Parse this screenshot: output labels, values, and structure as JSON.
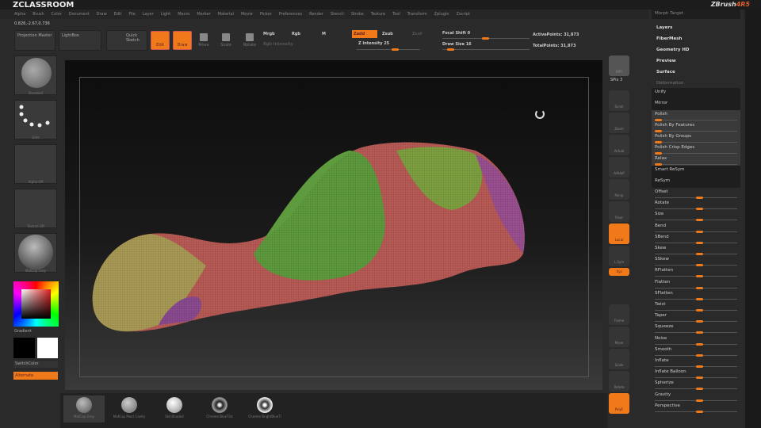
{
  "title": "ZCLASSROOM",
  "logo": {
    "main": "ZBrush",
    "version": "4R5"
  },
  "menu": [
    "Alpha",
    "Brush",
    "Color",
    "Document",
    "Draw",
    "Edit",
    "File",
    "Layer",
    "Light",
    "Macro",
    "Marker",
    "Material",
    "Movie",
    "Picker",
    "Preferences",
    "Render",
    "Stencil",
    "Stroke",
    "Texture",
    "Tool",
    "Transform",
    "Zplugin",
    "Zscript"
  ],
  "coords": "0.826,-2.67,0.736",
  "top": {
    "projection_master": "Projection Master",
    "lightbox": "LightBox",
    "quick_sketch": "Quick Sketch",
    "edit": "Edit",
    "draw": "Draw",
    "move": "Move",
    "scale": "Scale",
    "rotate": "Rotate",
    "mrgb": "Mrgb",
    "rgb": "Rgb",
    "m": "M",
    "rgb_intensity": "Rgb Intensity",
    "zadd": "Zadd",
    "zsub": "Zsub",
    "zcut": "Zcut",
    "z_intensity": "Z Intensity 25",
    "focal_shift": "Focal Shift 0",
    "draw_size": "Draw Size 16",
    "active_points": "ActivePoints: 31,873",
    "total_points": "TotalPoints: 31,873",
    "z_intensity_value": 25,
    "focal_shift_value": 0,
    "draw_size_value": 16
  },
  "left": {
    "brush": "Standard",
    "stroke": "Dots",
    "alpha": "Alpha Off",
    "texture": "Texture Off",
    "material": "MatCap Gray",
    "gradient": "Gradient",
    "switch_color": "SwitchColor",
    "alternate": "Alternate"
  },
  "right_shelf": [
    "Scroll",
    "Zoom",
    "Actual",
    "AAHalf",
    "Persp",
    "Floor",
    "Local",
    "L.Sym",
    "Xyz",
    "Frame",
    "Move",
    "Scale",
    "Rotate",
    "PolyF"
  ],
  "right_shelf_top": {
    "bpr": "BPR",
    "spix": "SPix 3"
  },
  "panel": {
    "top_item": "Morph Target",
    "sections": [
      "Layers",
      "FiberMesh",
      "Geometry HD",
      "Preview",
      "Surface",
      "Deformation"
    ],
    "buttons": [
      "Unify",
      "Mirror"
    ],
    "polish": [
      "Polish",
      "Polish By Features",
      "Polish By Groups",
      "Polish Crisp Edges",
      "Relax"
    ],
    "buttons2": [
      "Smart ReSym",
      "ReSym"
    ],
    "sliders": [
      "Offset",
      "Rotate",
      "Size",
      "Bend",
      "SBend",
      "Skew",
      "SSkew",
      "RFlatten",
      "Flatten",
      "SFlatten",
      "Twist",
      "Taper",
      "Squeeze",
      "Noise",
      "Smooth",
      "Inflate",
      "Inflate Balloon",
      "Spherize",
      "Gravity",
      "Perspective"
    ]
  },
  "materials": [
    "MatCap Gray",
    "MatCap Pearl Cavity",
    "SkinShade4",
    "Chrome BlueTint",
    "Chrome BrightBlueTi"
  ],
  "colors": {
    "accent": "#f07a1a",
    "red_group": "#b85a55",
    "green_group": "#5e9a3e",
    "yellow_group": "#a89a55",
    "purple_group": "#8a4a90"
  }
}
